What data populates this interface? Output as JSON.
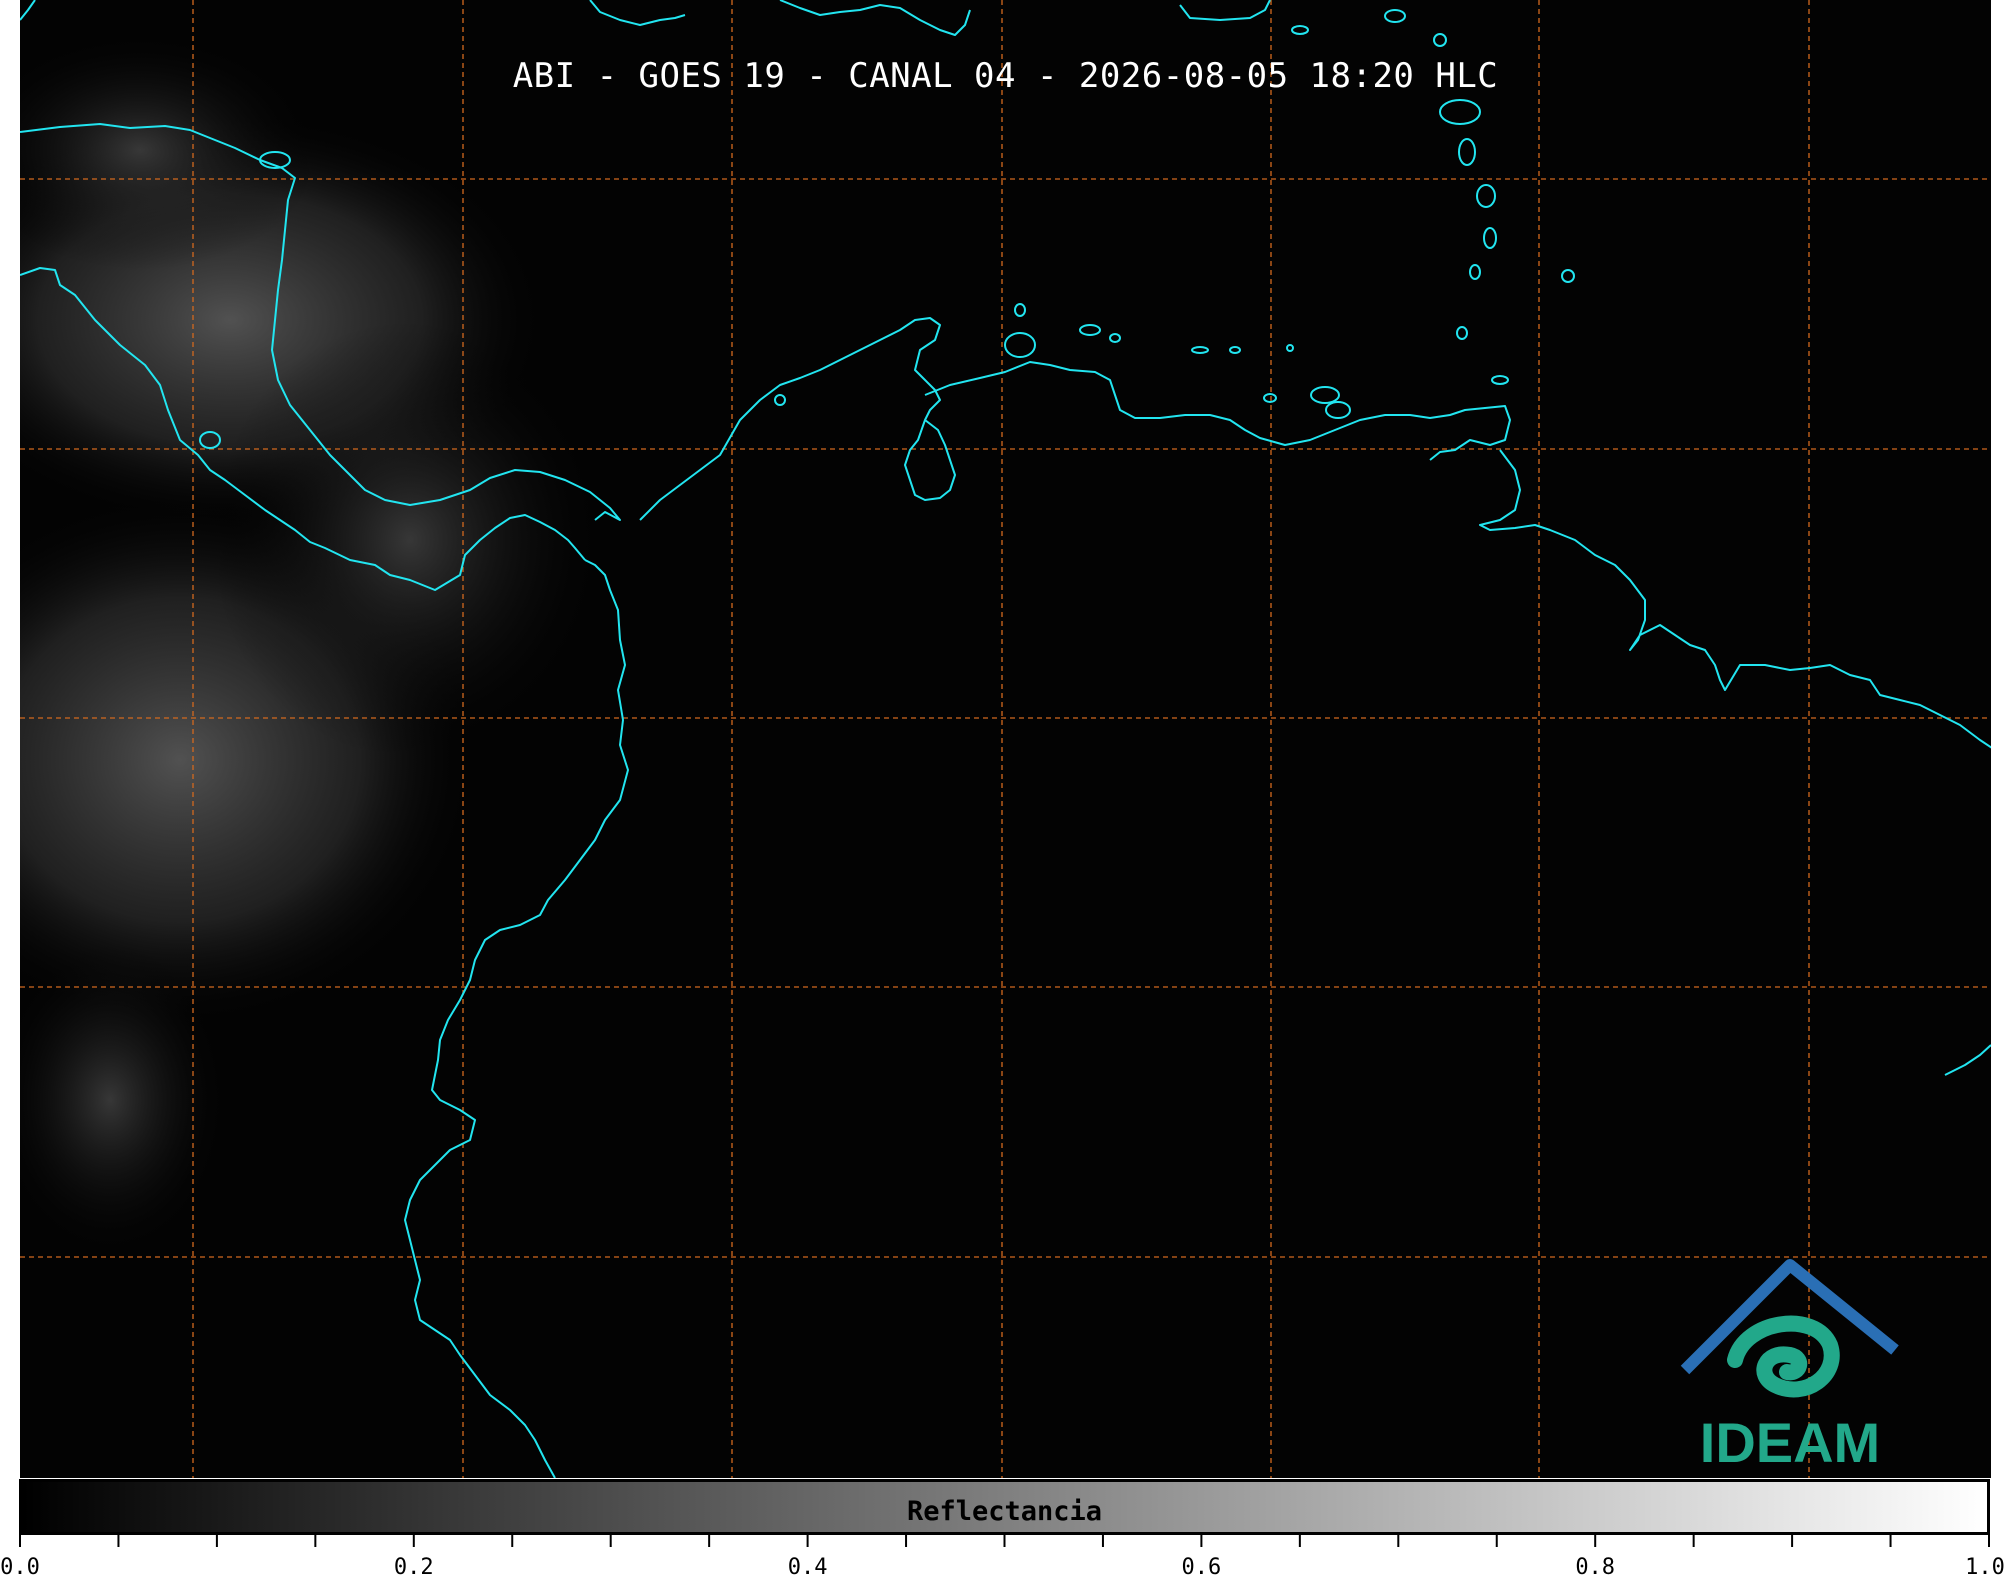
{
  "title": "ABI - GOES 19 - CANAL 04 - 2026-08-05 18:20 HLC",
  "colors": {
    "background": "#030303",
    "coastline": "#22e5f0",
    "grid": "#d2691e",
    "colorbar_start": "#000000",
    "colorbar_end": "#ffffff",
    "logo_green": "#22a88a",
    "logo_blue": "#2a6fb5"
  },
  "colorbar": {
    "label": "Reflectancia",
    "range": [
      0.0,
      1.0
    ],
    "tick_labels": [
      "0.0",
      "0.2",
      "0.4",
      "0.6",
      "0.8",
      "1.0"
    ],
    "minor_tick_step": 0.05
  },
  "logo": {
    "text": "IDEAM",
    "icon": "ideam-logo-icon"
  },
  "map": {
    "gridlines": true,
    "gridline_style": "dashed",
    "coastlines": true
  }
}
